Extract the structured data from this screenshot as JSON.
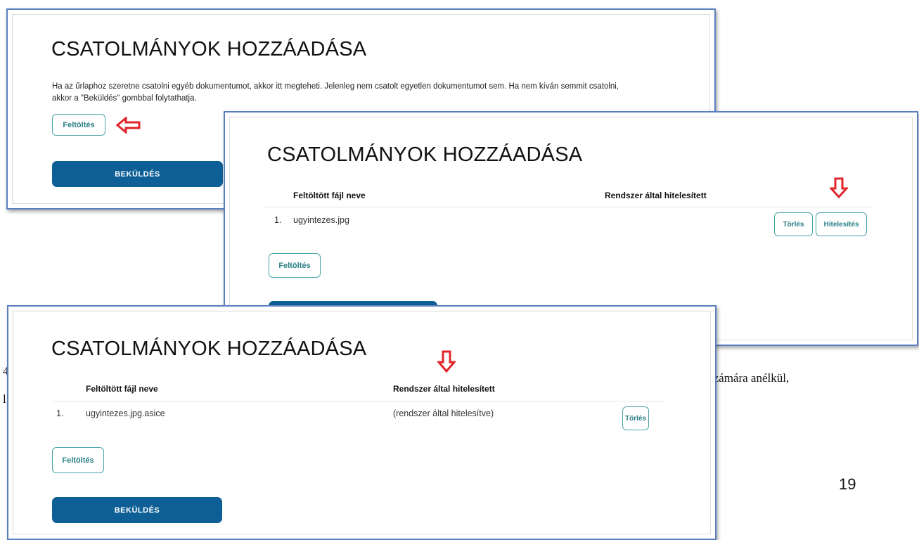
{
  "document": {
    "fragment_left_1": "4",
    "fragment_left_2": "l",
    "fragment_right": "számára anélkül,",
    "page_number": "19"
  },
  "screen1": {
    "title": "CSATOLMÁNYOK HOZZÁADÁSA",
    "intro_line1": "Ha az űrlaphoz szeretne csatolni egyéb dokumentumot, akkor itt megteheti. Jelenleg nem csatolt egyetlen dokumentumot sem. Ha nem kíván semmit csatolni,",
    "intro_line2": "akkor a \"Beküldés\" gombbal folytathatja.",
    "upload_label": "Feltöltés",
    "submit_label": "BEKÜLDÉS"
  },
  "screen2": {
    "title": "CSATOLMÁNYOK HOZZÁADÁSA",
    "columns": [
      "Feltöltött fájl neve",
      "Rendszer által hitelesített"
    ],
    "rows": [
      {
        "index": "1.",
        "filename": "ugyintezes.jpg",
        "status": ""
      }
    ],
    "delete_label": "Törlés",
    "authenticate_label": "Hitelesítés",
    "upload_label": "Feltöltés"
  },
  "screen3": {
    "title": "CSATOLMÁNYOK HOZZÁADÁSA",
    "columns": [
      "Feltöltött fájl neve",
      "Rendszer által hitelesített"
    ],
    "rows": [
      {
        "index": "1.",
        "filename": "ugyintezes.jpg.asice",
        "status": "(rendszer által hitelesítve)"
      }
    ],
    "delete_label": "Törlés",
    "upload_label": "Feltöltés",
    "submit_label": "BEKÜLDÉS"
  },
  "colors": {
    "frame_border": "#5a7fbf",
    "primary_button": "#0d5f96",
    "outline_button": "#4aa3a8",
    "annotation_arrow": "#e0252b"
  },
  "icons": [
    "arrow-left-icon",
    "arrow-down-icon"
  ]
}
